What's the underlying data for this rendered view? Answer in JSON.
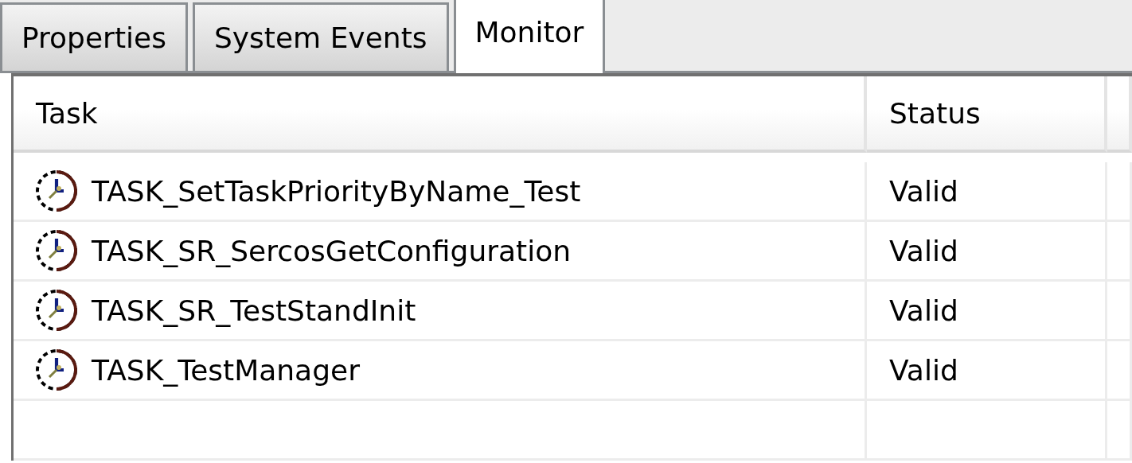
{
  "tabs": [
    {
      "label": "Properties",
      "selected": false
    },
    {
      "label": "System Events",
      "selected": false
    },
    {
      "label": "Monitor",
      "selected": true
    }
  ],
  "table": {
    "columns": [
      "Task",
      "Status"
    ],
    "rows": [
      {
        "task": "TASK_SetTaskPriorityByName_Test",
        "status": "Valid"
      },
      {
        "task": "TASK_SR_SercosGetConfiguration",
        "status": "Valid"
      },
      {
        "task": "TASK_SR_TestStandInit",
        "status": "Valid"
      },
      {
        "task": "TASK_TestManager",
        "status": "Valid"
      }
    ]
  }
}
